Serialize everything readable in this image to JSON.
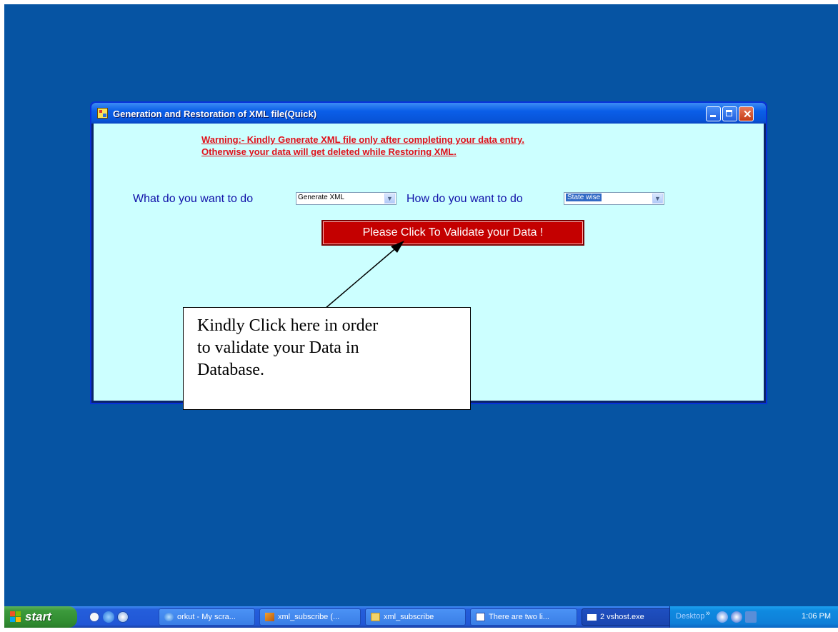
{
  "window": {
    "title": "Generation and Restoration of XML file(Quick)",
    "warning_line1": "Warning:- Kindly Generate XML file only after completing your data entry.",
    "warning_line2": "Otherwise your data will get deleted while Restoring XML.",
    "what_label": "What do you want to do",
    "what_value": "Generate XML",
    "how_label": "How do you want to do",
    "how_value": "State wise",
    "validate_button": "Please Click To Validate your Data !"
  },
  "callout": {
    "line1": "Kindly Click here in order",
    "line2": "to validate your Data in",
    "line3": "Database."
  },
  "taskbar": {
    "start_label": "start",
    "tasks": [
      {
        "label": "orkut - My scra..."
      },
      {
        "label": "xml_subscribe (..."
      },
      {
        "label": "xml_subscribe"
      },
      {
        "label": "There are two li..."
      },
      {
        "label": "2 vshost.exe"
      }
    ],
    "desktop_label": "Desktop",
    "clock": "1:06 PM"
  },
  "colors": {
    "desktop": "#0654a3",
    "client_bg": "#ccffff",
    "warning": "#e0101a",
    "label": "#1010a8",
    "button": "#c40000"
  }
}
